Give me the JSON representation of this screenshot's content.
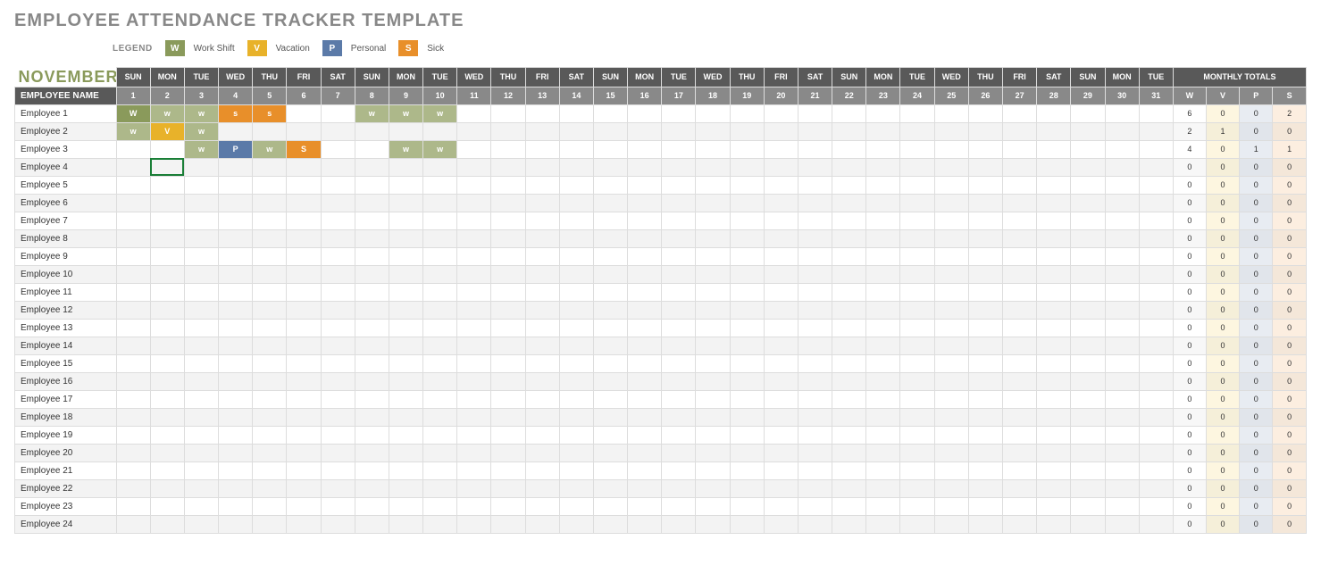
{
  "title": "EMPLOYEE ATTENDANCE TRACKER TEMPLATE",
  "legend": {
    "label": "LEGEND",
    "items": [
      {
        "code": "W",
        "text": "Work Shift",
        "color": "#8a9a5b"
      },
      {
        "code": "V",
        "text": "Vacation",
        "color": "#e8b22a"
      },
      {
        "code": "P",
        "text": "Personal",
        "color": "#5b7aa8"
      },
      {
        "code": "S",
        "text": "Sick",
        "color": "#e88f2a"
      }
    ]
  },
  "month": "NOVEMBER",
  "headers": {
    "emp_col": "EMPLOYEE NAME",
    "days_of_week": [
      "SUN",
      "MON",
      "TUE",
      "WED",
      "THU",
      "FRI",
      "SAT",
      "SUN",
      "MON",
      "TUE",
      "WED",
      "THU",
      "FRI",
      "SAT",
      "SUN",
      "MON",
      "TUE",
      "WED",
      "THU",
      "FRI",
      "SAT",
      "SUN",
      "MON",
      "TUE",
      "WED",
      "THU",
      "FRI",
      "SAT",
      "SUN",
      "MON",
      "TUE"
    ],
    "day_numbers": [
      "1",
      "2",
      "3",
      "4",
      "5",
      "6",
      "7",
      "8",
      "9",
      "10",
      "11",
      "12",
      "13",
      "14",
      "15",
      "16",
      "17",
      "18",
      "19",
      "20",
      "21",
      "22",
      "23",
      "24",
      "25",
      "26",
      "27",
      "28",
      "29",
      "30",
      "31"
    ],
    "totals_header": "MONTHLY TOTALS",
    "totals_cols": [
      "W",
      "V",
      "P",
      "S"
    ]
  },
  "employees": [
    {
      "name": "Employee 1",
      "cells": {
        "0": "W",
        "1": "w",
        "2": "w",
        "3": "s",
        "4": "s",
        "7": "w",
        "8": "w",
        "9": "w"
      },
      "totals": {
        "W": 6,
        "V": 0,
        "P": 0,
        "S": 2
      }
    },
    {
      "name": "Employee 2",
      "cells": {
        "0": "w",
        "1": "V",
        "2": "w"
      },
      "totals": {
        "W": 2,
        "V": 1,
        "P": 0,
        "S": 0
      }
    },
    {
      "name": "Employee 3",
      "cells": {
        "2": "w",
        "3": "P",
        "4": "w",
        "5": "S",
        "8": "w",
        "9": "w"
      },
      "totals": {
        "W": 4,
        "V": 0,
        "P": 1,
        "S": 1
      }
    },
    {
      "name": "Employee 4",
      "cells": {},
      "totals": {
        "W": 0,
        "V": 0,
        "P": 0,
        "S": 0
      },
      "activeCol": 1
    },
    {
      "name": "Employee 5",
      "cells": {},
      "totals": {
        "W": 0,
        "V": 0,
        "P": 0,
        "S": 0
      }
    },
    {
      "name": "Employee 6",
      "cells": {},
      "totals": {
        "W": 0,
        "V": 0,
        "P": 0,
        "S": 0
      }
    },
    {
      "name": "Employee 7",
      "cells": {},
      "totals": {
        "W": 0,
        "V": 0,
        "P": 0,
        "S": 0
      }
    },
    {
      "name": "Employee 8",
      "cells": {},
      "totals": {
        "W": 0,
        "V": 0,
        "P": 0,
        "S": 0
      }
    },
    {
      "name": "Employee 9",
      "cells": {},
      "totals": {
        "W": 0,
        "V": 0,
        "P": 0,
        "S": 0
      }
    },
    {
      "name": "Employee 10",
      "cells": {},
      "totals": {
        "W": 0,
        "V": 0,
        "P": 0,
        "S": 0
      }
    },
    {
      "name": "Employee 11",
      "cells": {},
      "totals": {
        "W": 0,
        "V": 0,
        "P": 0,
        "S": 0
      }
    },
    {
      "name": "Employee 12",
      "cells": {},
      "totals": {
        "W": 0,
        "V": 0,
        "P": 0,
        "S": 0
      }
    },
    {
      "name": "Employee 13",
      "cells": {},
      "totals": {
        "W": 0,
        "V": 0,
        "P": 0,
        "S": 0
      }
    },
    {
      "name": "Employee 14",
      "cells": {},
      "totals": {
        "W": 0,
        "V": 0,
        "P": 0,
        "S": 0
      }
    },
    {
      "name": "Employee 15",
      "cells": {},
      "totals": {
        "W": 0,
        "V": 0,
        "P": 0,
        "S": 0
      }
    },
    {
      "name": "Employee 16",
      "cells": {},
      "totals": {
        "W": 0,
        "V": 0,
        "P": 0,
        "S": 0
      }
    },
    {
      "name": "Employee 17",
      "cells": {},
      "totals": {
        "W": 0,
        "V": 0,
        "P": 0,
        "S": 0
      }
    },
    {
      "name": "Employee 18",
      "cells": {},
      "totals": {
        "W": 0,
        "V": 0,
        "P": 0,
        "S": 0
      }
    },
    {
      "name": "Employee 19",
      "cells": {},
      "totals": {
        "W": 0,
        "V": 0,
        "P": 0,
        "S": 0
      }
    },
    {
      "name": "Employee 20",
      "cells": {},
      "totals": {
        "W": 0,
        "V": 0,
        "P": 0,
        "S": 0
      }
    },
    {
      "name": "Employee 21",
      "cells": {},
      "totals": {
        "W": 0,
        "V": 0,
        "P": 0,
        "S": 0
      }
    },
    {
      "name": "Employee 22",
      "cells": {},
      "totals": {
        "W": 0,
        "V": 0,
        "P": 0,
        "S": 0
      }
    },
    {
      "name": "Employee 23",
      "cells": {},
      "totals": {
        "W": 0,
        "V": 0,
        "P": 0,
        "S": 0
      }
    },
    {
      "name": "Employee 24",
      "cells": {},
      "totals": {
        "W": 0,
        "V": 0,
        "P": 0,
        "S": 0
      }
    }
  ],
  "dropdown_options": [
    "W",
    "V",
    "P",
    "S"
  ]
}
